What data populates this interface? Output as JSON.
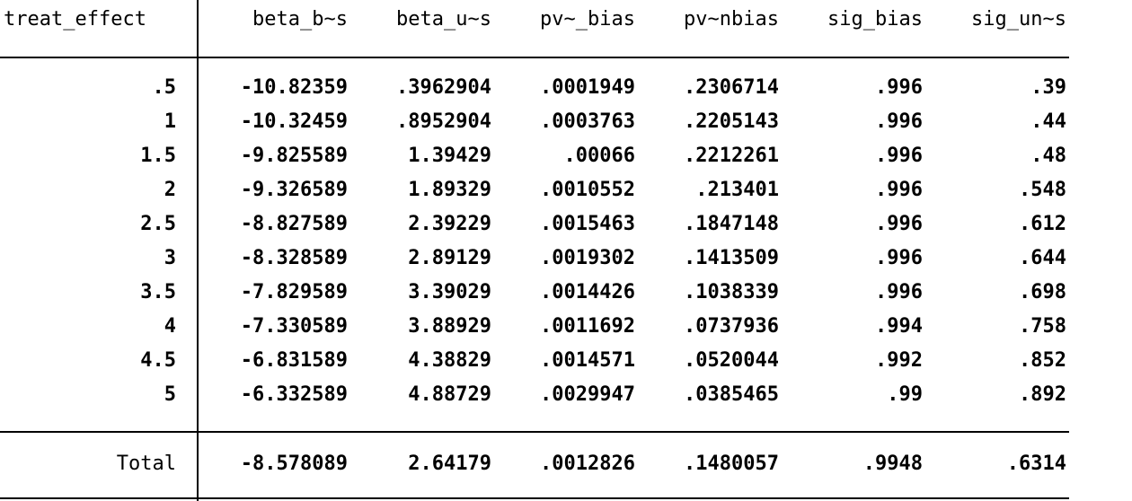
{
  "table": {
    "headers": [
      "treat_effect",
      "beta_b~s",
      "beta_u~s",
      "pv~_bias",
      "pv~nbias",
      "sig_bias",
      "sig_un~s"
    ],
    "rows": [
      [
        ".5",
        "-10.82359",
        ".3962904",
        ".0001949",
        ".2306714",
        ".996",
        ".39"
      ],
      [
        "1",
        "-10.32459",
        ".8952904",
        ".0003763",
        ".2205143",
        ".996",
        ".44"
      ],
      [
        "1.5",
        "-9.825589",
        "1.39429",
        ".00066",
        ".2212261",
        ".996",
        ".48"
      ],
      [
        "2",
        "-9.326589",
        "1.89329",
        ".0010552",
        ".213401",
        ".996",
        ".548"
      ],
      [
        "2.5",
        "-8.827589",
        "2.39229",
        ".0015463",
        ".1847148",
        ".996",
        ".612"
      ],
      [
        "3",
        "-8.328589",
        "2.89129",
        ".0019302",
        ".1413509",
        ".996",
        ".644"
      ],
      [
        "3.5",
        "-7.829589",
        "3.39029",
        ".0014426",
        ".1038339",
        ".996",
        ".698"
      ],
      [
        "4",
        "-7.330589",
        "3.88929",
        ".0011692",
        ".0737936",
        ".994",
        ".758"
      ],
      [
        "4.5",
        "-6.831589",
        "4.38829",
        ".0014571",
        ".0520044",
        ".992",
        ".852"
      ],
      [
        "5",
        "-6.332589",
        "4.88729",
        ".0029947",
        ".0385465",
        ".99",
        ".892"
      ]
    ],
    "total": [
      "Total",
      "-8.578089",
      "2.64179",
      ".0012826",
      ".1480057",
      ".9948",
      ".6314"
    ]
  }
}
